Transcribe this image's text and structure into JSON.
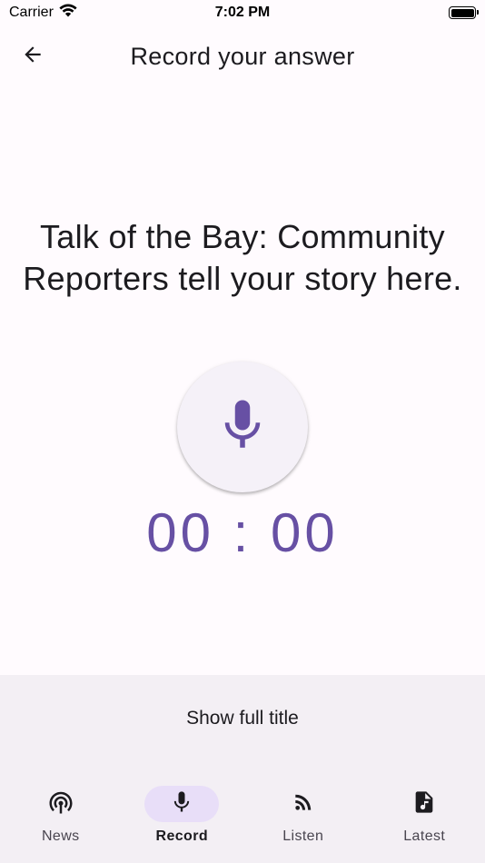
{
  "status_bar": {
    "carrier": "Carrier",
    "time": "7:02 PM",
    "icons": [
      "wifi-icon",
      "battery-icon"
    ]
  },
  "app_bar": {
    "title": "Record your answer",
    "back_icon": "arrow-back-icon"
  },
  "main": {
    "prompt": "Talk of the Bay: Community Reporters tell your story here.",
    "mic_icon": "microphone-icon",
    "timer": "00 : 00"
  },
  "bottom": {
    "show_title_label": "Show full title"
  },
  "nav": {
    "items": [
      {
        "label": "News",
        "icon": "podcast-icon",
        "active": false
      },
      {
        "label": "Record",
        "icon": "microphone-icon",
        "active": true
      },
      {
        "label": "Listen",
        "icon": "rss-feed-icon",
        "active": false
      },
      {
        "label": "Latest",
        "icon": "audio-file-icon",
        "active": false
      }
    ]
  },
  "colors": {
    "background": "#fffbfe",
    "accent": "#6750a4",
    "indicator": "#e8def8",
    "panel": "#f3eff4"
  }
}
